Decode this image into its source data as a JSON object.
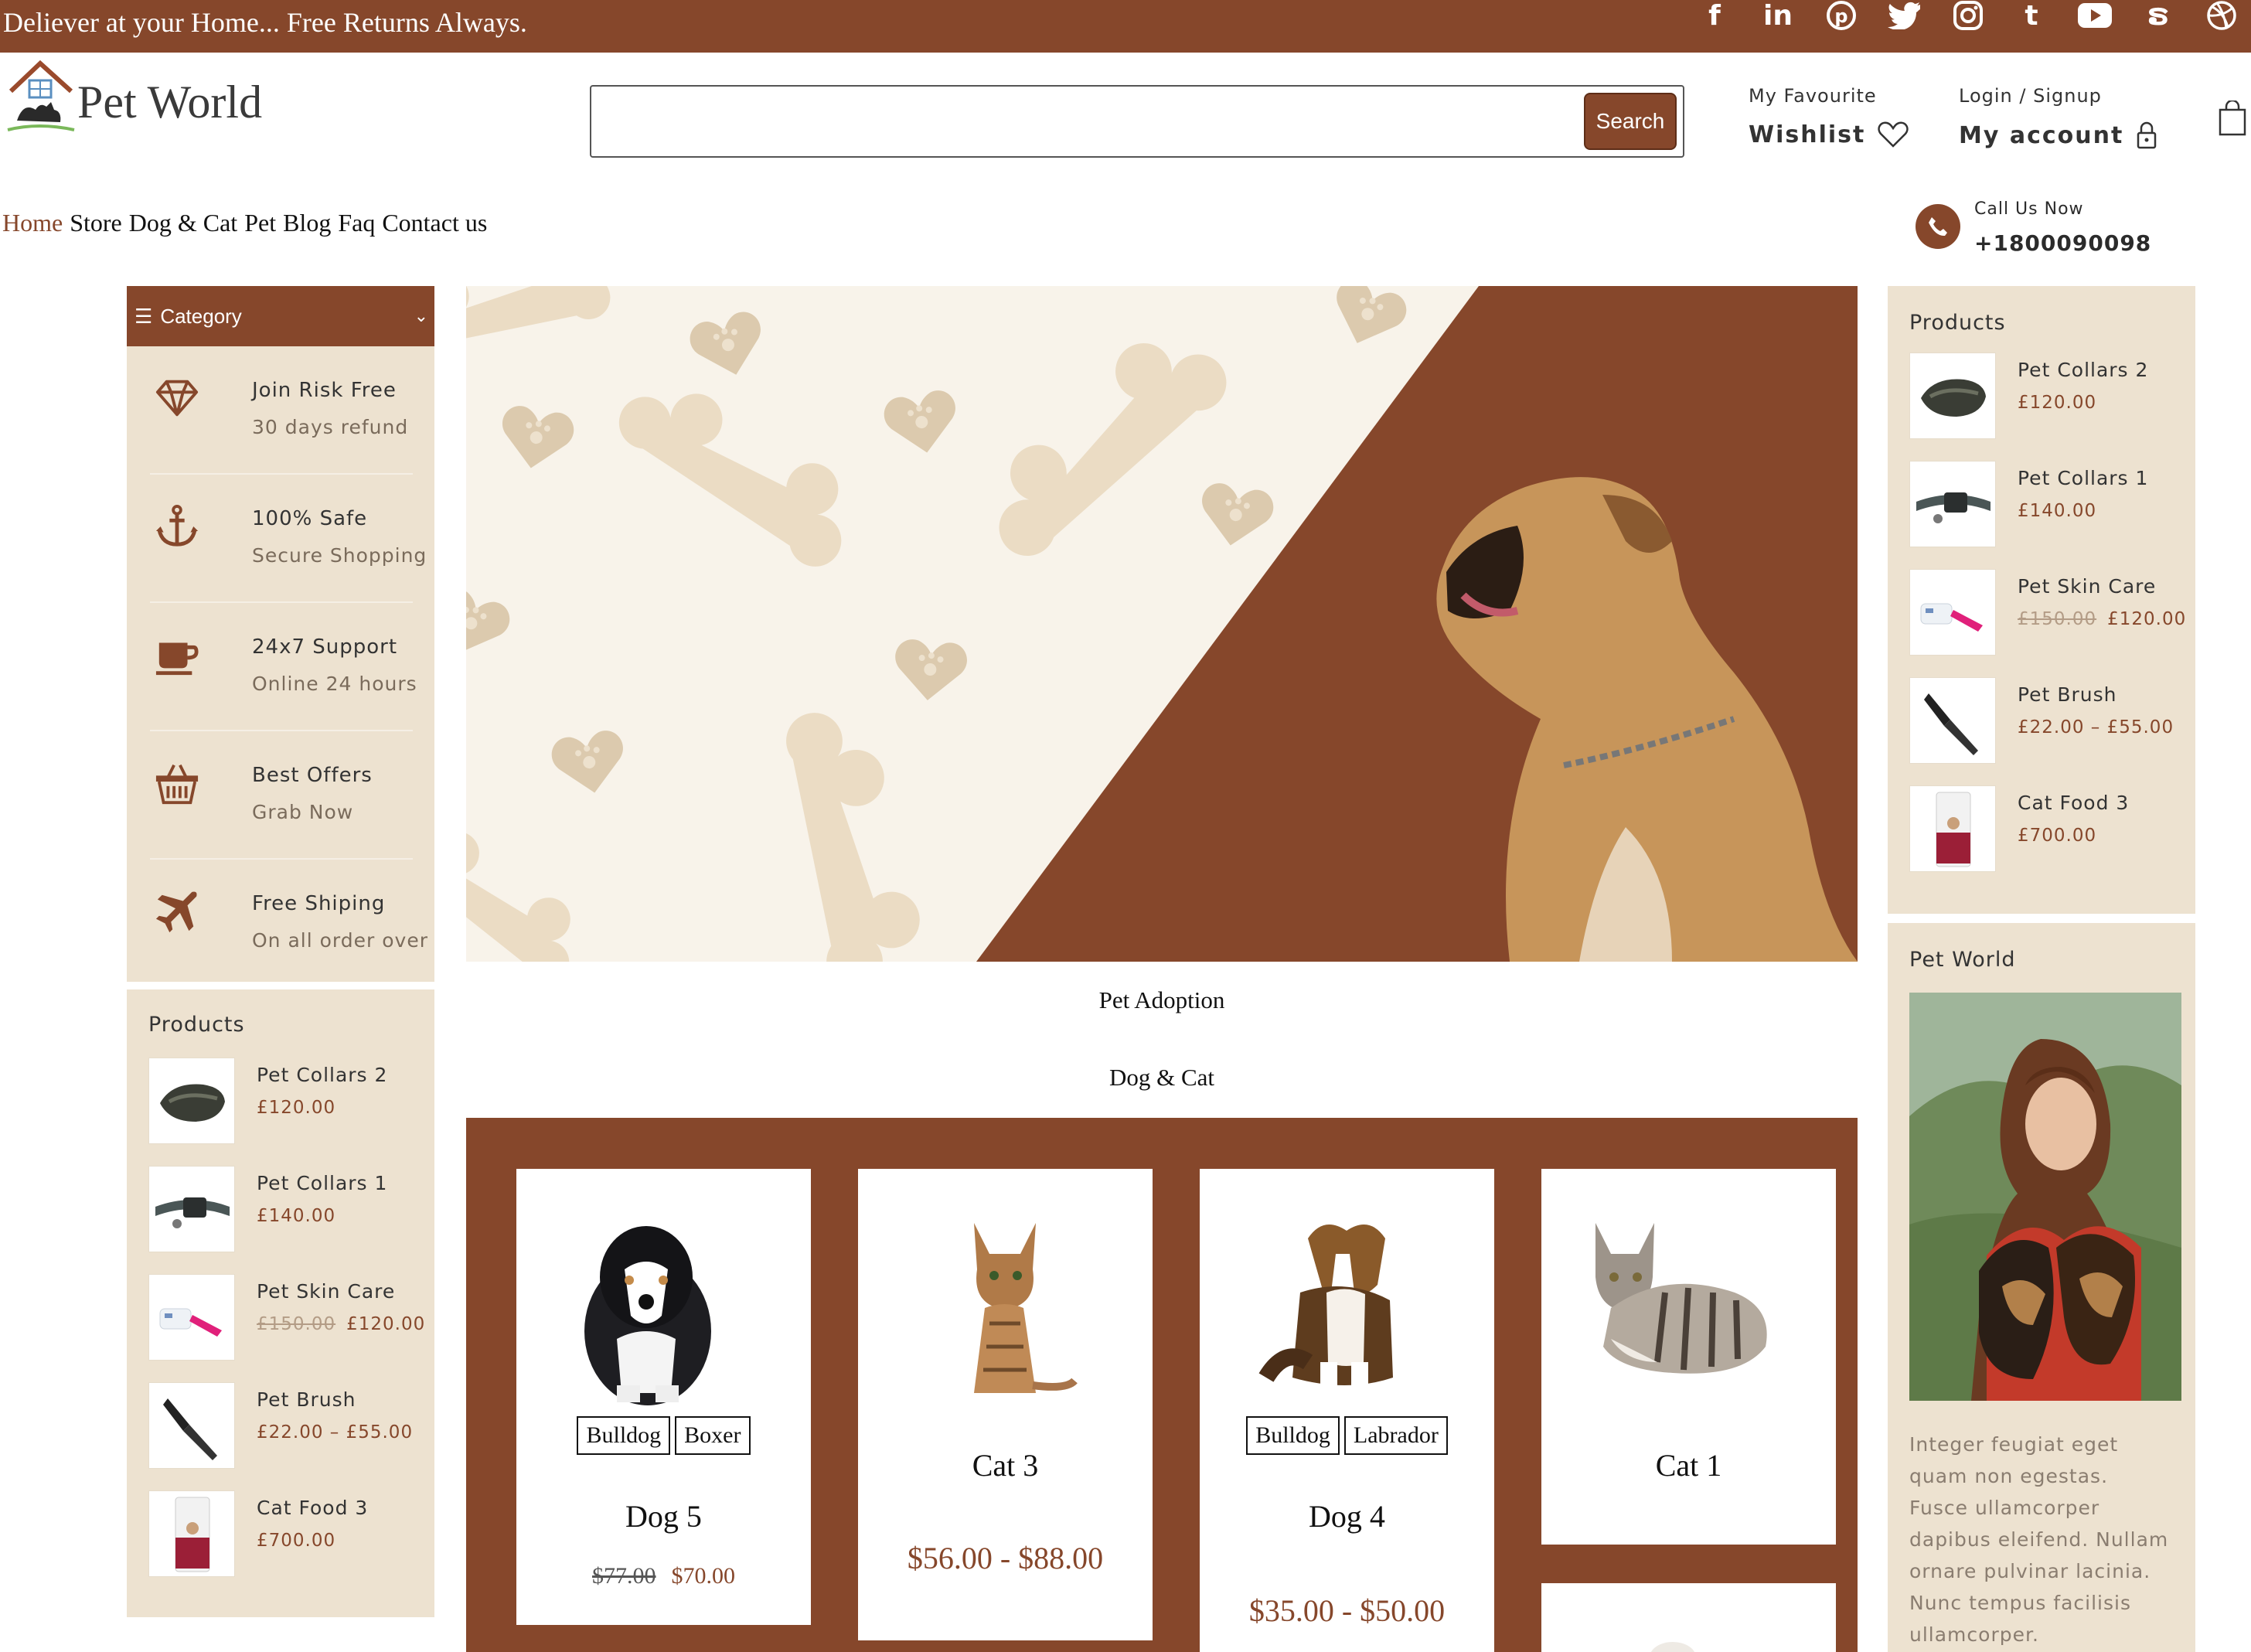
{
  "topbar": {
    "message": "Deliever at your Home... Free Returns Always.",
    "socials": [
      "facebook-icon",
      "linkedin-icon",
      "pinterest-icon",
      "twitter-icon",
      "instagram-icon",
      "tumblr-icon",
      "youtube-icon",
      "stumbleupon-icon",
      "dribbble-icon"
    ]
  },
  "header": {
    "logo_text": "Pet World",
    "search_placeholder": "",
    "search_button": "Search",
    "wishlist_small": "My Favourite",
    "wishlist_big": "Wishlist",
    "account_small": "Login / Signup",
    "account_big": "My account"
  },
  "nav": {
    "items": [
      "Home",
      "Store",
      "Dog & Cat",
      "Pet",
      "Blog",
      "Faq",
      "Contact us"
    ],
    "active": "Home"
  },
  "call": {
    "label": "Call Us Now",
    "number": "+1800090098"
  },
  "category": {
    "title": "Category"
  },
  "features": [
    {
      "icon": "diamond-icon",
      "title": "Join Risk Free",
      "subtitle": "30 days refund"
    },
    {
      "icon": "anchor-icon",
      "title": "100% Safe",
      "subtitle": "Secure Shopping"
    },
    {
      "icon": "coffee-cup-icon",
      "title": "24x7 Support",
      "subtitle": "Online 24 hours"
    },
    {
      "icon": "basket-icon",
      "title": "Best Offers",
      "subtitle": "Grab Now"
    },
    {
      "icon": "plane-icon",
      "title": "Free Shiping",
      "subtitle": "On all order over"
    }
  ],
  "products_widget": {
    "title": "Products",
    "items": [
      {
        "name": "Pet Collars 2",
        "price": "£120.00",
        "old_price": ""
      },
      {
        "name": "Pet Collars 1",
        "price": "£140.00",
        "old_price": ""
      },
      {
        "name": "Pet Skin Care",
        "price": "£120.00",
        "old_price": "£150.00"
      },
      {
        "name": "Pet Brush",
        "price": "£22.00 – £55.00",
        "old_price": ""
      },
      {
        "name": "Cat Food 3",
        "price": "£700.00",
        "old_price": ""
      }
    ]
  },
  "sections": {
    "adoption": "Pet Adoption",
    "dogcat": "Dog & Cat"
  },
  "cards": [
    {
      "name": "Dog 5",
      "tags": [
        "Bulldog",
        "Boxer"
      ],
      "price": "$70.00",
      "old_price": "$77.00"
    },
    {
      "name": "Cat 3",
      "tags": [],
      "price": "$56.00 - $88.00",
      "old_price": ""
    },
    {
      "name": "Dog 4",
      "tags": [
        "Bulldog",
        "Labrador"
      ],
      "price": "$35.00 - $50.00",
      "old_price": ""
    },
    {
      "name": "Cat 1",
      "tags": [],
      "price": "",
      "old_price": ""
    }
  ],
  "pet_world_widget": {
    "title": "Pet World",
    "text": "Integer feugiat eget quam non egestas. Fusce ullamcorper dapibus eleifend. Nullam ornare pulvinar lacinia. Nunc tempus facilisis ullamcorper."
  },
  "colors": {
    "brand": "#86472b",
    "beige": "#ede2d0"
  }
}
